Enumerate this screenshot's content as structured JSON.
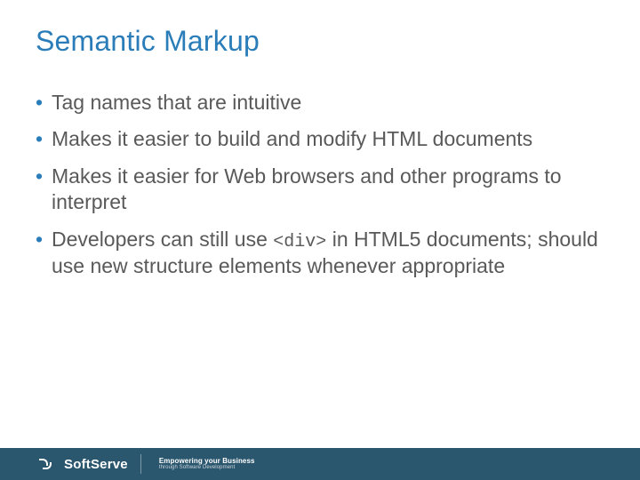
{
  "title": "Semantic Markup",
  "bullets": [
    {
      "text": "Tag names that are intuitive"
    },
    {
      "text": "Makes it easier to build and modify HTML documents"
    },
    {
      "text": "Makes it easier for Web browsers and other programs to interpret"
    },
    {
      "prefix": "Developers can still use ",
      "code": "<div>",
      "suffix": " in HTML5 documents; should use new structure elements whenever appropriate"
    }
  ],
  "footer": {
    "brand": "SoftServe",
    "tagline_top": "Empowering your Business",
    "tagline_bottom": "through Software Development"
  }
}
